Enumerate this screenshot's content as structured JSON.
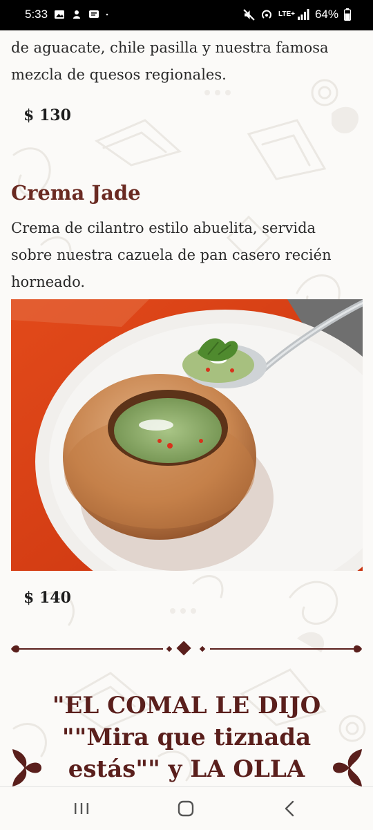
{
  "status_bar": {
    "time": "5:33",
    "left_icons": [
      "image-icon",
      "hand-icon",
      "message-icon",
      "dot-icon"
    ],
    "right_icons": [
      "mute-icon",
      "hotspot-icon",
      "lte-signal-icon",
      "battery-icon"
    ],
    "network": "LTE+",
    "battery": "64%"
  },
  "menu": {
    "prev_dish": {
      "description_tail": "de aguacate, chile pasilla y nuestra famosa mezcla de quesos regionales.",
      "price": "$ 130"
    },
    "dish": {
      "name": "Crema Jade",
      "description": "Crema de cilantro estilo abuelita, servida sobre nuestra cazuela de pan casero recién horneado.",
      "price": "$ 140",
      "photo_icon": "soup-bread-bowl-photo"
    },
    "quote": "\"EL COMAL LE DIJO \"\"Mira que tiznada estás\"\" y LA OLLA"
  },
  "nav_bar": {
    "buttons": [
      "recent-apps-icon",
      "home-icon",
      "back-icon"
    ]
  },
  "colors": {
    "title": "#6a2a22",
    "quote": "#5a1f1c",
    "text": "#2a2a2a",
    "background": "#fbfaf8"
  }
}
